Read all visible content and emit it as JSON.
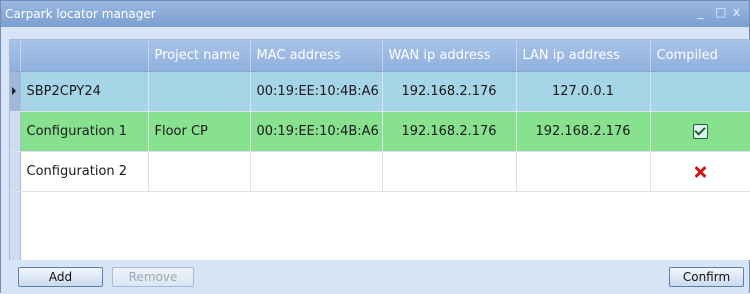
{
  "window": {
    "title": "Carpark locator manager",
    "controls": [
      "_",
      "□",
      "x"
    ]
  },
  "grid": {
    "columns": [
      "",
      "Project name",
      "MAC address",
      "WAN ip address",
      "LAN ip address",
      "Compiled"
    ],
    "rows": [
      {
        "name": "SBP2CPY24",
        "project": "",
        "mac": "00:19:EE:10:4B:A6",
        "wan": "192.168.2.176",
        "lan": "127.0.0.1",
        "compiled": "none"
      },
      {
        "name": "Configuration 1",
        "project": "Floor CP",
        "mac": "00:19:EE:10:4B:A6",
        "wan": "192.168.2.176",
        "lan": "192.168.2.176",
        "compiled": "yes"
      },
      {
        "name": "Configuration 2",
        "project": "",
        "mac": "",
        "wan": "",
        "lan": "",
        "compiled": "no"
      }
    ]
  },
  "buttons": {
    "add": "Add",
    "remove": "Remove",
    "confirm": "Confirm"
  },
  "colors": {
    "selected_row": "#a7d5e8",
    "compiled_row": "#87e18f",
    "header": "#8fb0de"
  },
  "icons": {
    "compiled_yes": "checkmark-icon",
    "compiled_no": "red-x-icon",
    "row_pointer": "triangle-right-icon"
  }
}
